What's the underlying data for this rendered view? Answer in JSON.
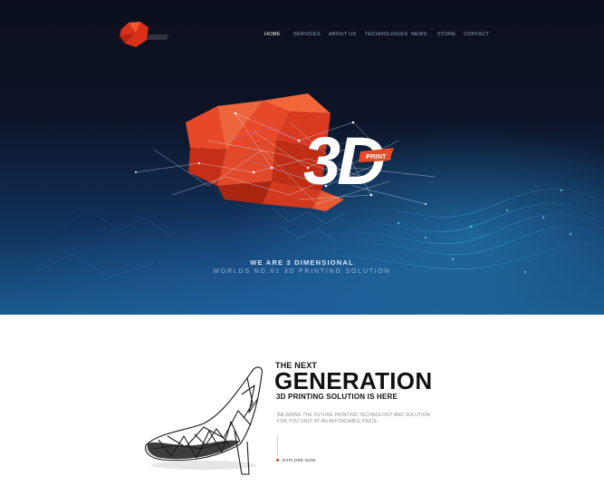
{
  "logo": {
    "text": "3D",
    "sub_text": "3 DIMENSIONAL",
    "brand_color": "#d9301a"
  },
  "nav": {
    "items": [
      {
        "label": "HOME",
        "active": true
      },
      {
        "label": "SERVICES",
        "active": false
      },
      {
        "label": "ABOUT US",
        "active": false
      },
      {
        "label": "TECHNOLOGIES",
        "active": false
      },
      {
        "label": "NEWS",
        "active": false
      },
      {
        "label": "STORE",
        "active": false
      },
      {
        "label": "CONTACT",
        "active": false
      }
    ]
  },
  "hero": {
    "art_big_text": "3D",
    "art_badge_text": "PRINT",
    "tagline_1": "WE ARE 3 DIMENSIONAL",
    "tagline_2": "WORLDS NO.01 3D PRINTING SOLUTION"
  },
  "feature": {
    "title_small": "THE NEXT",
    "title_big": "GENERATION",
    "subtitle": "3D PRINTING SOLUTION IS HERE",
    "description": "WE BRING THE FUTURE PRINTING TECHNOLOGY AND SOLUTION FOR YOU ONLY AT AN AFFORDABLE PRICE",
    "cta_label": "EXPLORE NOW"
  },
  "colors": {
    "accent": "#e03c1f",
    "hero_dark": "#0b0f1c",
    "hero_blue": "#1a5a8c"
  },
  "icons": {
    "logo": "3d-logo-icon",
    "hero": "polygon-network-icon",
    "product": "3d-printed-shoe-icon"
  }
}
